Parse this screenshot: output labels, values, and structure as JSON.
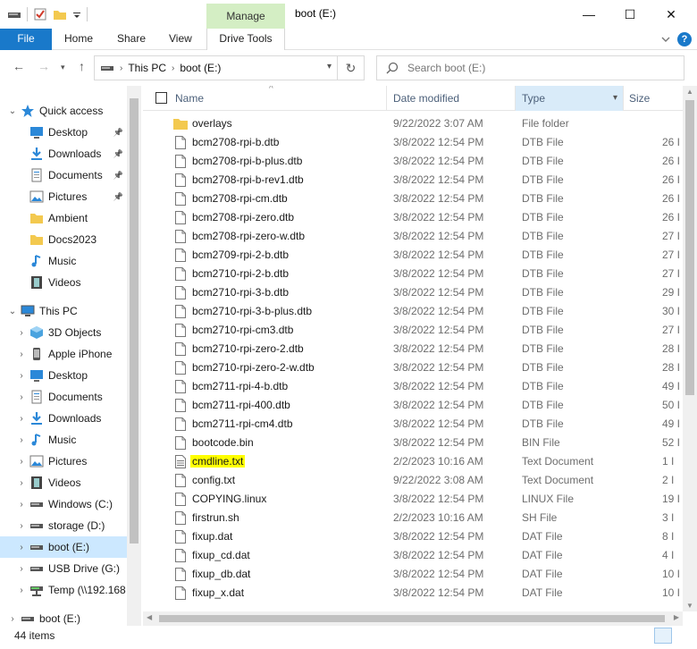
{
  "window": {
    "title": "boot (E:)",
    "context_tab": "Manage",
    "minimize": "—",
    "maximize": "☐",
    "close": "✕"
  },
  "ribbon": {
    "tabs": [
      "File",
      "Home",
      "Share",
      "View",
      "Drive Tools"
    ],
    "help": "?"
  },
  "address": {
    "crumbs": [
      "This PC",
      "boot (E:)"
    ],
    "search_placeholder": "Search boot (E:)"
  },
  "nav": {
    "items": [
      {
        "label": "Quick access",
        "icon": "star-icon",
        "pinned": false
      },
      {
        "label": "Desktop",
        "icon": "desktop-icon",
        "pinned": true
      },
      {
        "label": "Downloads",
        "icon": "download-icon",
        "pinned": true
      },
      {
        "label": "Documents",
        "icon": "document-icon",
        "pinned": true
      },
      {
        "label": "Pictures",
        "icon": "pictures-icon",
        "pinned": true
      },
      {
        "label": "Ambient",
        "icon": "folder-icon",
        "pinned": false
      },
      {
        "label": "Docs2023",
        "icon": "folder-icon",
        "pinned": false
      },
      {
        "label": "Music",
        "icon": "music-icon",
        "pinned": false
      },
      {
        "label": "Videos",
        "icon": "video-icon",
        "pinned": false
      },
      {
        "label": "This PC",
        "icon": "computer-icon",
        "pinned": false
      },
      {
        "label": "3D Objects",
        "icon": "cube-icon",
        "pinned": false
      },
      {
        "label": "Apple iPhone",
        "icon": "phone-icon",
        "pinned": false
      },
      {
        "label": "Desktop",
        "icon": "desktop-icon",
        "pinned": false
      },
      {
        "label": "Documents",
        "icon": "document-icon",
        "pinned": false
      },
      {
        "label": "Downloads",
        "icon": "download-icon",
        "pinned": false
      },
      {
        "label": "Music",
        "icon": "music-icon",
        "pinned": false
      },
      {
        "label": "Pictures",
        "icon": "pictures-icon",
        "pinned": false
      },
      {
        "label": "Videos",
        "icon": "video-icon",
        "pinned": false
      },
      {
        "label": "Windows (C:)",
        "icon": "drive-icon",
        "pinned": false
      },
      {
        "label": "storage (D:)",
        "icon": "drive-icon",
        "pinned": false
      },
      {
        "label": "boot (E:)",
        "icon": "drive-icon",
        "pinned": false
      },
      {
        "label": "USB Drive (G:)",
        "icon": "drive-icon",
        "pinned": false
      },
      {
        "label": "Temp (\\\\192.168",
        "icon": "network-drive-icon",
        "pinned": false
      },
      {
        "label": "boot (E:)",
        "icon": "drive-icon",
        "pinned": false
      }
    ]
  },
  "columns": {
    "name": "Name",
    "date": "Date modified",
    "type": "Type",
    "size": "Size"
  },
  "files": [
    {
      "name": "overlays",
      "date": "9/22/2022 3:07 AM",
      "type": "File folder",
      "size": "",
      "kind": "folder"
    },
    {
      "name": "bcm2708-rpi-b.dtb",
      "date": "3/8/2022 12:54 PM",
      "type": "DTB File",
      "size": "26 I",
      "kind": "file"
    },
    {
      "name": "bcm2708-rpi-b-plus.dtb",
      "date": "3/8/2022 12:54 PM",
      "type": "DTB File",
      "size": "26 I",
      "kind": "file"
    },
    {
      "name": "bcm2708-rpi-b-rev1.dtb",
      "date": "3/8/2022 12:54 PM",
      "type": "DTB File",
      "size": "26 I",
      "kind": "file"
    },
    {
      "name": "bcm2708-rpi-cm.dtb",
      "date": "3/8/2022 12:54 PM",
      "type": "DTB File",
      "size": "26 I",
      "kind": "file"
    },
    {
      "name": "bcm2708-rpi-zero.dtb",
      "date": "3/8/2022 12:54 PM",
      "type": "DTB File",
      "size": "26 I",
      "kind": "file"
    },
    {
      "name": "bcm2708-rpi-zero-w.dtb",
      "date": "3/8/2022 12:54 PM",
      "type": "DTB File",
      "size": "27 I",
      "kind": "file"
    },
    {
      "name": "bcm2709-rpi-2-b.dtb",
      "date": "3/8/2022 12:54 PM",
      "type": "DTB File",
      "size": "27 I",
      "kind": "file"
    },
    {
      "name": "bcm2710-rpi-2-b.dtb",
      "date": "3/8/2022 12:54 PM",
      "type": "DTB File",
      "size": "27 I",
      "kind": "file"
    },
    {
      "name": "bcm2710-rpi-3-b.dtb",
      "date": "3/8/2022 12:54 PM",
      "type": "DTB File",
      "size": "29 I",
      "kind": "file"
    },
    {
      "name": "bcm2710-rpi-3-b-plus.dtb",
      "date": "3/8/2022 12:54 PM",
      "type": "DTB File",
      "size": "30 I",
      "kind": "file"
    },
    {
      "name": "bcm2710-rpi-cm3.dtb",
      "date": "3/8/2022 12:54 PM",
      "type": "DTB File",
      "size": "27 I",
      "kind": "file"
    },
    {
      "name": "bcm2710-rpi-zero-2.dtb",
      "date": "3/8/2022 12:54 PM",
      "type": "DTB File",
      "size": "28 I",
      "kind": "file"
    },
    {
      "name": "bcm2710-rpi-zero-2-w.dtb",
      "date": "3/8/2022 12:54 PM",
      "type": "DTB File",
      "size": "28 I",
      "kind": "file"
    },
    {
      "name": "bcm2711-rpi-4-b.dtb",
      "date": "3/8/2022 12:54 PM",
      "type": "DTB File",
      "size": "49 I",
      "kind": "file"
    },
    {
      "name": "bcm2711-rpi-400.dtb",
      "date": "3/8/2022 12:54 PM",
      "type": "DTB File",
      "size": "50 I",
      "kind": "file"
    },
    {
      "name": "bcm2711-rpi-cm4.dtb",
      "date": "3/8/2022 12:54 PM",
      "type": "DTB File",
      "size": "49 I",
      "kind": "file"
    },
    {
      "name": "bootcode.bin",
      "date": "3/8/2022 12:54 PM",
      "type": "BIN File",
      "size": "52 I",
      "kind": "file"
    },
    {
      "name": "cmdline.txt",
      "date": "2/2/2023 10:16 AM",
      "type": "Text Document",
      "size": "1 I",
      "kind": "text",
      "highlight": true
    },
    {
      "name": "config.txt",
      "date": "9/22/2022 3:08 AM",
      "type": "Text Document",
      "size": "2 I",
      "kind": "file"
    },
    {
      "name": "COPYING.linux",
      "date": "3/8/2022 12:54 PM",
      "type": "LINUX File",
      "size": "19 I",
      "kind": "file"
    },
    {
      "name": "firstrun.sh",
      "date": "2/2/2023 10:16 AM",
      "type": "SH File",
      "size": "3 I",
      "kind": "file"
    },
    {
      "name": "fixup.dat",
      "date": "3/8/2022 12:54 PM",
      "type": "DAT File",
      "size": "8 I",
      "kind": "file"
    },
    {
      "name": "fixup_cd.dat",
      "date": "3/8/2022 12:54 PM",
      "type": "DAT File",
      "size": "4 I",
      "kind": "file"
    },
    {
      "name": "fixup_db.dat",
      "date": "3/8/2022 12:54 PM",
      "type": "DAT File",
      "size": "10 I",
      "kind": "file"
    },
    {
      "name": "fixup_x.dat",
      "date": "3/8/2022 12:54 PM",
      "type": "DAT File",
      "size": "10 I",
      "kind": "file"
    }
  ],
  "status": {
    "count": "44 items"
  },
  "colors": {
    "accent": "#1979ca",
    "manage_tab": "#d4eec4",
    "selection": "#cce8ff",
    "highlight": "#ffff00"
  }
}
